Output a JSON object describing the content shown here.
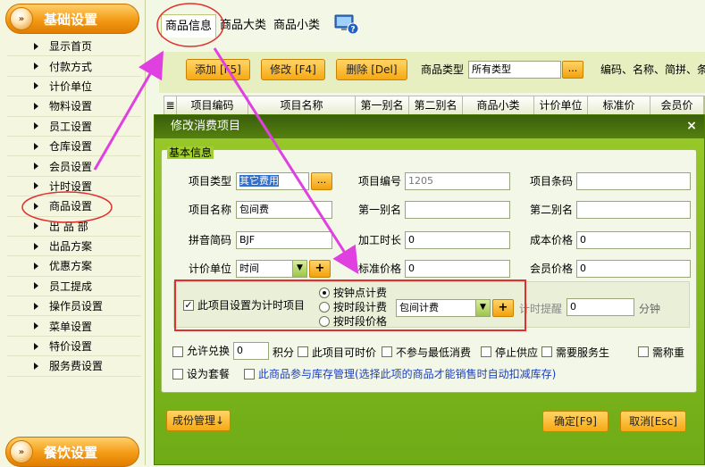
{
  "sidebar": {
    "section1_title": "基础设置",
    "section2_title": "餐饮设置",
    "items": [
      {
        "label": "显示首页"
      },
      {
        "label": "付款方式"
      },
      {
        "label": "计价单位"
      },
      {
        "label": "物料设置"
      },
      {
        "label": "员工设置"
      },
      {
        "label": "仓库设置"
      },
      {
        "label": "会员设置"
      },
      {
        "label": "计时设置"
      },
      {
        "label": "商品设置"
      },
      {
        "label": "出 品 部"
      },
      {
        "label": "出品方案"
      },
      {
        "label": "优惠方案"
      },
      {
        "label": "员工提成"
      },
      {
        "label": "操作员设置"
      },
      {
        "label": "菜单设置"
      },
      {
        "label": "特价设置"
      },
      {
        "label": "服务费设置"
      }
    ]
  },
  "tabs": [
    {
      "label": "商品信息"
    },
    {
      "label": "商品大类"
    },
    {
      "label": "商品小类"
    }
  ],
  "toolbar": {
    "add_label": "添加 [F5]",
    "edit_label": "修改 [F4]",
    "delete_label": "删除 [Del]",
    "type_label": "商品类型",
    "type_value": "所有类型",
    "dots": "...",
    "hint": "编码、名称、简拼、条"
  },
  "grid": {
    "headers": [
      "项目编码",
      "项目名称",
      "第一别名",
      "第二别名",
      "商品小类",
      "计价单位",
      "标准价",
      "会员价"
    ]
  },
  "dialog": {
    "title": "修改消费项目",
    "close": "×",
    "basic_legend": "基本信息",
    "fields": {
      "item_type_label": "项目类型",
      "item_type_value": "其它费用",
      "item_code_label": "项目编号",
      "item_code_value": "1205",
      "barcode_label": "项目条码",
      "barcode_value": "",
      "item_name_label": "项目名称",
      "item_name_value": "包间费",
      "alias1_label": "第一别名",
      "alias1_value": "",
      "alias2_label": "第二别名",
      "alias2_value": "",
      "pinyin_label": "拼音简码",
      "pinyin_value": "BJF",
      "duration_label": "加工时长",
      "duration_value": "0",
      "cost_label": "成本价格",
      "cost_value": "0",
      "unit_label": "计价单位",
      "unit_value": "时间",
      "std_price_label": "标准价格",
      "std_price_value": "0",
      "member_price_label": "会员价格",
      "member_price_value": "0"
    },
    "timed": {
      "check_label": "此项目设置为计时项目",
      "check_mark": "✓",
      "radio1": "按钟点计费",
      "radio2": "按时段计费",
      "radio3": "按时段价格",
      "plan_value": "包间计费",
      "remind_label": "计时提醒",
      "remind_value": "0",
      "remind_unit": "分钟"
    },
    "options": {
      "exchange_label": "允许兑换",
      "exchange_value": "0",
      "points_label": "积分",
      "timed_price_label": "此项目可时价",
      "no_min_label": "不参与最低消费",
      "stop_supply_label": "停止供应",
      "need_server_label": "需要服务生",
      "need_weigh_label": "需称重",
      "set_meal_label": "设为套餐",
      "inventory_label": "此商品参与库存管理(选择此项的商品才能销售时自动扣减库存)"
    },
    "buttons": {
      "components": "成份管理↓",
      "ok": "确定[F9]",
      "cancel": "取消[Esc]"
    }
  },
  "colors": {
    "accent_orange": "#f39a15",
    "dialog_green": "#8cc021",
    "annotation_magenta": "#e040e0",
    "annotation_red": "#e03030"
  }
}
